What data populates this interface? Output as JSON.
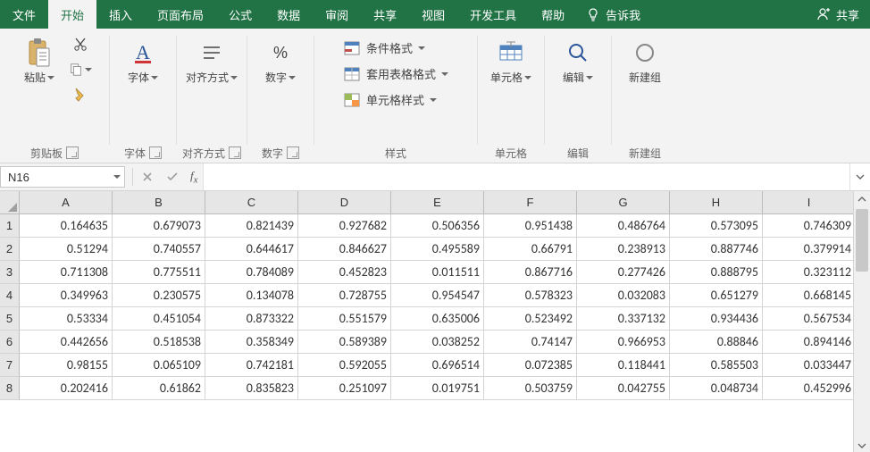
{
  "tabs": {
    "file": "文件",
    "home": "开始",
    "insert": "插入",
    "layout": "页面布局",
    "formulas": "公式",
    "data": "数据",
    "review": "审阅",
    "share_tab": "共享",
    "view": "视图",
    "dev": "开发工具",
    "help": "帮助",
    "tell": "告诉我",
    "share": "共享"
  },
  "ribbon": {
    "clipboard": {
      "paste": "粘贴",
      "label": "剪贴板"
    },
    "font": {
      "btn": "字体",
      "label": "字体"
    },
    "align": {
      "btn": "对齐方式",
      "label": "对齐方式"
    },
    "number": {
      "btn": "数字",
      "label": "数字"
    },
    "styles": {
      "cond": "条件格式",
      "table": "套用表格格式",
      "cell": "单元格样式",
      "label": "样式"
    },
    "cells": {
      "btn": "单元格",
      "label": "单元格"
    },
    "editing": {
      "btn": "编辑",
      "label": "编辑"
    },
    "newgroup": {
      "btn": "新建组",
      "label": "新建组"
    }
  },
  "fbar": {
    "name": "N16"
  },
  "cols": [
    "A",
    "B",
    "C",
    "D",
    "E",
    "F",
    "G",
    "H",
    "I"
  ],
  "rows": [
    "1",
    "2",
    "3",
    "4",
    "5",
    "6",
    "7",
    "8"
  ],
  "chart_data": {
    "type": "table",
    "columns": [
      "A",
      "B",
      "C",
      "D",
      "E",
      "F",
      "G",
      "H",
      "I"
    ],
    "data": [
      [
        "0.164635",
        "0.679073",
        "0.821439",
        "0.927682",
        "0.506356",
        "0.951438",
        "0.486764",
        "0.573095",
        "0.746309"
      ],
      [
        "0.51294",
        "0.740557",
        "0.644617",
        "0.846627",
        "0.495589",
        "0.66791",
        "0.238913",
        "0.887746",
        "0.379914"
      ],
      [
        "0.711308",
        "0.775511",
        "0.784089",
        "0.452823",
        "0.011511",
        "0.867716",
        "0.277426",
        "0.888795",
        "0.323112"
      ],
      [
        "0.349963",
        "0.230575",
        "0.134078",
        "0.728755",
        "0.954547",
        "0.578323",
        "0.032083",
        "0.651279",
        "0.668145"
      ],
      [
        "0.53334",
        "0.451054",
        "0.873322",
        "0.551579",
        "0.635006",
        "0.523492",
        "0.337132",
        "0.934436",
        "0.567534"
      ],
      [
        "0.442656",
        "0.518538",
        "0.358349",
        "0.589389",
        "0.038252",
        "0.74147",
        "0.966953",
        "0.88846",
        "0.894146"
      ],
      [
        "0.98155",
        "0.065109",
        "0.742181",
        "0.592055",
        "0.696514",
        "0.072385",
        "0.118441",
        "0.585503",
        "0.033447"
      ],
      [
        "0.202416",
        "0.61862",
        "0.835823",
        "0.251097",
        "0.019751",
        "0.503759",
        "0.042755",
        "0.048734",
        "0.452996"
      ]
    ]
  }
}
